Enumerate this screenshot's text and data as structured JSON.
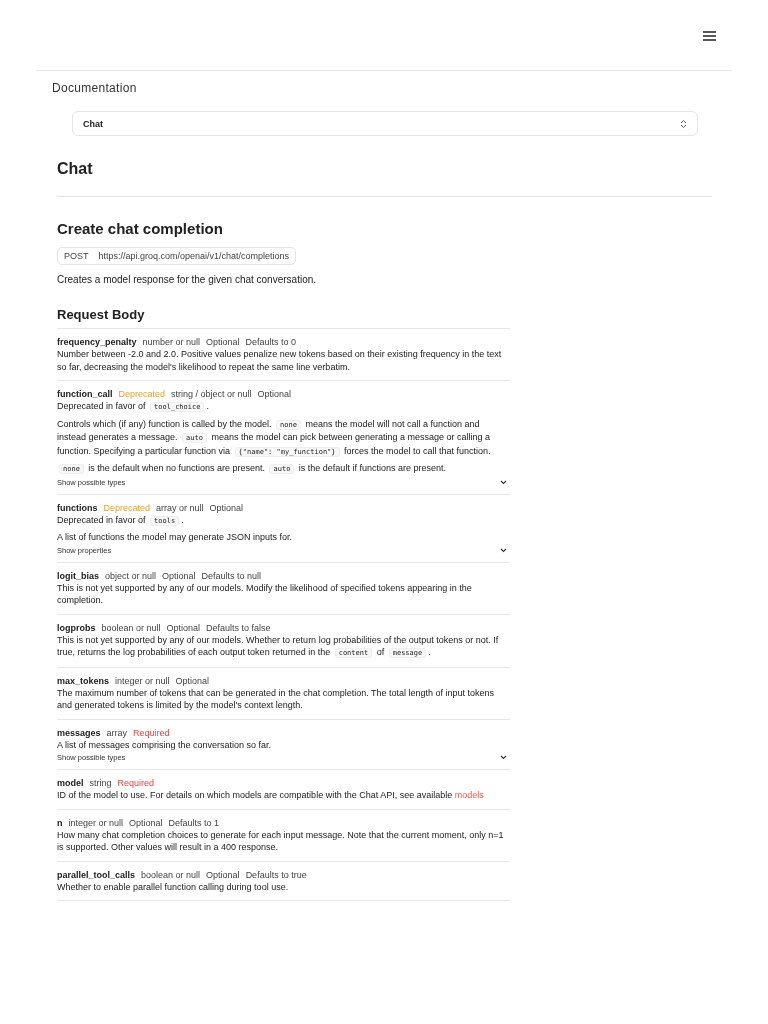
{
  "header": {
    "section_title": "Documentation"
  },
  "select": {
    "value": "Chat"
  },
  "page_title": "Chat",
  "endpoint": {
    "title": "Create chat completion",
    "method": "POST",
    "url": "https://api.groq.com/openai/v1/chat/completions",
    "description": "Creates a model response for the given chat conversation."
  },
  "request_body": {
    "title": "Request Body",
    "params": [
      {
        "name": "frequency_penalty",
        "type": "number or null",
        "status": {
          "kind": "optional",
          "text": "Optional"
        },
        "default": "Defaults to 0",
        "paragraphs": [
          [
            {
              "kind": "text",
              "text": "Number between -2.0 and 2.0. Positive values penalize new tokens based on their existing frequency in the text so far, decreasing the model's likelihood to repeat the same line verbatim."
            }
          ]
        ]
      },
      {
        "name": "function_call",
        "deprecated": "Deprecated",
        "type": "string / object or null",
        "status": {
          "kind": "optional",
          "text": "Optional"
        },
        "paragraphs": [
          [
            {
              "kind": "text",
              "text": "Deprecated in favor of "
            },
            {
              "kind": "code",
              "text": "tool_choice"
            },
            {
              "kind": "text",
              "text": "."
            }
          ],
          [
            {
              "kind": "text",
              "text": "Controls which (if any) function is called by the model. "
            },
            {
              "kind": "code",
              "text": "none"
            },
            {
              "kind": "text",
              "text": " means the model will not call a function and instead generates a message. "
            },
            {
              "kind": "code",
              "text": "auto"
            },
            {
              "kind": "text",
              "text": " means the model can pick between generating a message or calling a function. Specifying a particular function via "
            },
            {
              "kind": "code",
              "text": "{\"name\": \"my_function\"}"
            },
            {
              "kind": "text",
              "text": " forces the model to call that function."
            }
          ],
          [
            {
              "kind": "code",
              "text": "none"
            },
            {
              "kind": "text",
              "text": " is the default when no functions are present. "
            },
            {
              "kind": "code",
              "text": "auto"
            },
            {
              "kind": "text",
              "text": " is the default if functions are present."
            }
          ]
        ],
        "toggle": "Show possible types"
      },
      {
        "name": "functions",
        "deprecated": "Deprecated",
        "type": "array or null",
        "status": {
          "kind": "optional",
          "text": "Optional"
        },
        "paragraphs": [
          [
            {
              "kind": "text",
              "text": "Deprecated in favor of "
            },
            {
              "kind": "code",
              "text": "tools"
            },
            {
              "kind": "text",
              "text": "."
            }
          ],
          [
            {
              "kind": "text",
              "text": "A list of functions the model may generate JSON inputs for."
            }
          ]
        ],
        "toggle": "Show properties"
      },
      {
        "name": "logit_bias",
        "type": "object or null",
        "status": {
          "kind": "optional",
          "text": "Optional"
        },
        "default": "Defaults to null",
        "paragraphs": [
          [
            {
              "kind": "text",
              "text": "This is not yet supported by any of our models. Modify the likelihood of specified tokens appearing in the completion."
            }
          ]
        ]
      },
      {
        "name": "logprobs",
        "type": "boolean or null",
        "status": {
          "kind": "optional",
          "text": "Optional"
        },
        "default": "Defaults to false",
        "paragraphs": [
          [
            {
              "kind": "text",
              "text": "This is not yet supported by any of our models. Whether to return log probabilities of the output tokens or not. If true, returns the log probabilities of each output token returned in the "
            },
            {
              "kind": "code",
              "text": "content"
            },
            {
              "kind": "text",
              "text": " of "
            },
            {
              "kind": "code",
              "text": "message"
            },
            {
              "kind": "text",
              "text": "."
            }
          ]
        ]
      },
      {
        "name": "max_tokens",
        "type": "integer or null",
        "status": {
          "kind": "optional",
          "text": "Optional"
        },
        "paragraphs": [
          [
            {
              "kind": "text",
              "text": "The maximum number of tokens that can be generated in the chat completion. The total length of input tokens and generated tokens is limited by the model's context length."
            }
          ]
        ]
      },
      {
        "name": "messages",
        "type": "array",
        "status": {
          "kind": "required",
          "text": "Required"
        },
        "paragraphs": [
          [
            {
              "kind": "text",
              "text": "A list of messages comprising the conversation so far."
            }
          ]
        ],
        "toggle": "Show possible types"
      },
      {
        "name": "model",
        "type": "string",
        "status": {
          "kind": "required",
          "text": "Required"
        },
        "paragraphs": [
          [
            {
              "kind": "text",
              "text": "ID of the model to use. For details on which models are compatible with the Chat API, see available "
            },
            {
              "kind": "link",
              "text": "models"
            }
          ]
        ]
      },
      {
        "name": "n",
        "type": "integer or null",
        "status": {
          "kind": "optional",
          "text": "Optional"
        },
        "default": "Defaults to 1",
        "paragraphs": [
          [
            {
              "kind": "text",
              "text": "How many chat completion choices to generate for each input message. Note that the current moment, only n=1 is supported. Other values will result in a 400 response."
            }
          ]
        ]
      },
      {
        "name": "parallel_tool_calls",
        "type": "boolean or null",
        "status": {
          "kind": "optional",
          "text": "Optional"
        },
        "default": "Defaults to true",
        "paragraphs": [
          [
            {
              "kind": "text",
              "text": "Whether to enable parallel function calling during tool use."
            }
          ]
        ]
      }
    ]
  }
}
